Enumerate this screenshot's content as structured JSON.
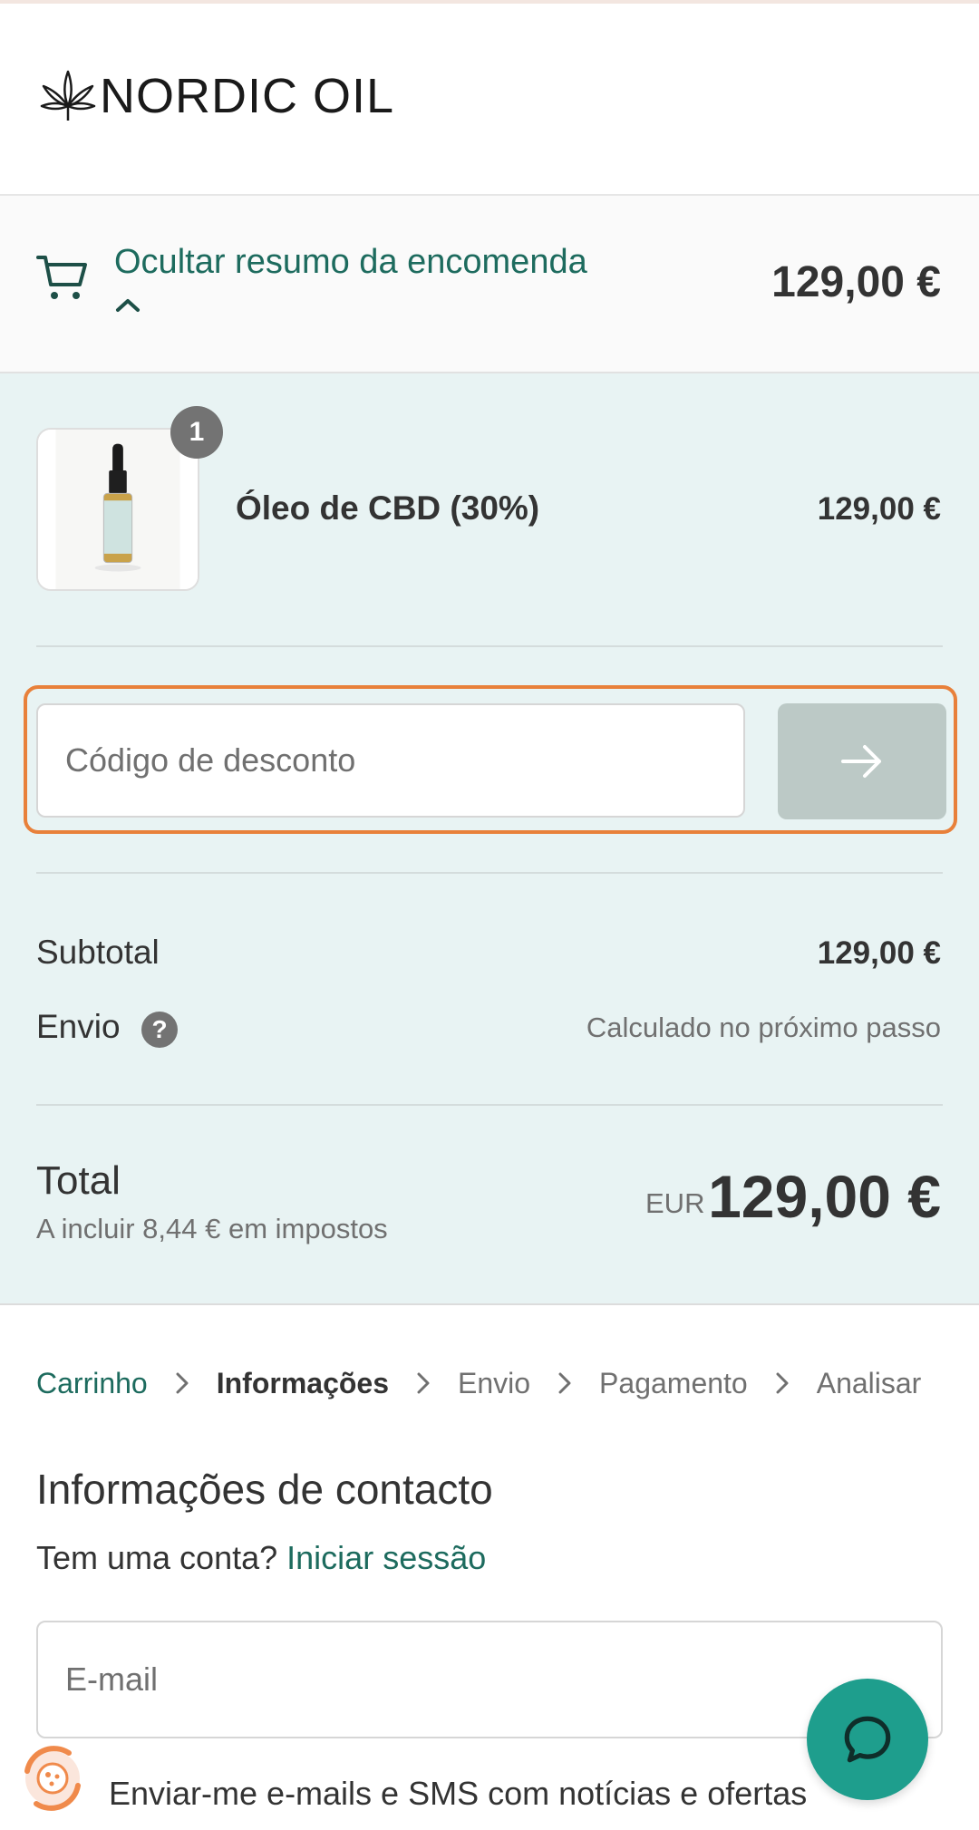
{
  "header": {
    "logo_text": "NORDIC OIL"
  },
  "summary_toggle": {
    "label": "Ocultar resumo da encomenda",
    "total": "129,00 €"
  },
  "order": {
    "items": [
      {
        "name": "Óleo de CBD (30%)",
        "price": "129,00 €",
        "quantity": "1"
      }
    ],
    "discount": {
      "placeholder": "Código de desconto"
    },
    "subtotal": {
      "label": "Subtotal",
      "value": "129,00 €"
    },
    "shipping": {
      "label": "Envio",
      "value": "Calculado no próximo passo"
    },
    "total": {
      "label": "Total",
      "tax_note": "A incluir 8,44 € em impostos",
      "currency": "EUR",
      "value": "129,00 €"
    }
  },
  "breadcrumb": {
    "items": [
      "Carrinho",
      "Informações",
      "Envio",
      "Pagamento",
      "Analisar"
    ],
    "current_index": 1
  },
  "contact": {
    "title": "Informações de contacto",
    "account_prompt": "Tem uma conta?",
    "login_link": "Iniciar sessão",
    "email_placeholder": "E-mail",
    "newsletter_label": "Enviar-me e-mails e SMS com notícias e ofertas"
  },
  "colors": {
    "accent": "#1d6b5e",
    "summary_bg": "#e8f3f3",
    "focus_ring": "#e8803a",
    "chat_button": "#1e9e8d"
  },
  "icons": {
    "cart": "cart-icon",
    "chevron": "chevron-up-icon",
    "arrow": "arrow-right-icon",
    "help": "question-icon",
    "chat": "chat-bubble-icon"
  }
}
